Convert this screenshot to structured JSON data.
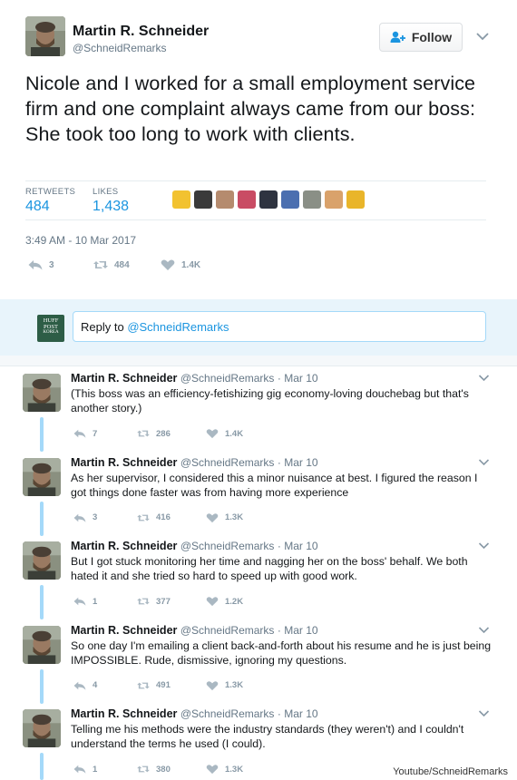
{
  "main_tweet": {
    "name": "Martin R. Schneider",
    "handle": "@SchneidRemarks",
    "follow_label": "Follow",
    "text": "Nicole and I worked for a small employment service firm and one complaint always came from our boss: She took too long to work with clients.",
    "retweets_label": "RETWEETS",
    "retweets": "484",
    "likes_label": "LIKES",
    "likes": "1,438",
    "timestamp": "3:49 AM - 10 Mar 2017",
    "actions": {
      "replies": "3",
      "retweets": "484",
      "likes": "1.4K"
    },
    "liker_colors": [
      "#f2c230",
      "#3a3a3a",
      "#b58b6e",
      "#c94c64",
      "#2e3340",
      "#4b6fb0",
      "#8a8f86",
      "#d9a26b",
      "#e9b52a"
    ]
  },
  "reply": {
    "logo_lines": [
      "HUFF",
      "POST",
      "KOREA"
    ],
    "prefix": "Reply to ",
    "mention": "@SchneidRemarks"
  },
  "thread": [
    {
      "name": "Martin R. Schneider",
      "handle": "@SchneidRemarks",
      "date": "· Mar 10",
      "text": "(This boss was an efficiency-fetishizing gig economy-loving douchebag but that's another story.)",
      "replies": "7",
      "retweets": "286",
      "likes": "1.4K"
    },
    {
      "name": "Martin R. Schneider",
      "handle": "@SchneidRemarks",
      "date": "· Mar 10",
      "text": "As her supervisor, I considered this a minor nuisance at best. I figured the reason I got things done faster was from having more experience",
      "replies": "3",
      "retweets": "416",
      "likes": "1.3K"
    },
    {
      "name": "Martin R. Schneider",
      "handle": "@SchneidRemarks",
      "date": "· Mar 10",
      "text": "But I got stuck monitoring her time and nagging her on the boss' behalf. We both hated it and she tried so hard to speed up with good work.",
      "replies": "1",
      "retweets": "377",
      "likes": "1.2K"
    },
    {
      "name": "Martin R. Schneider",
      "handle": "@SchneidRemarks",
      "date": "· Mar 10",
      "text": "So one day I'm emailing a client back-and-forth about his resume and he is just being IMPOSSIBLE. Rude, dismissive, ignoring my questions.",
      "replies": "4",
      "retweets": "491",
      "likes": "1.3K"
    },
    {
      "name": "Martin R. Schneider",
      "handle": "@SchneidRemarks",
      "date": "· Mar 10",
      "text": "Telling me his methods were the industry standards (they weren't) and I couldn't understand the terms he used (I could).",
      "replies": "1",
      "retweets": "380",
      "likes": "1.3K"
    }
  ],
  "credit": "Youtube/SchneidRemarks",
  "colors": {
    "link": "#1b95e0",
    "muted": "#657786",
    "icon": "#aab8c2",
    "connector": "#a4d9f9",
    "reply_band": "#e8f4fb"
  }
}
